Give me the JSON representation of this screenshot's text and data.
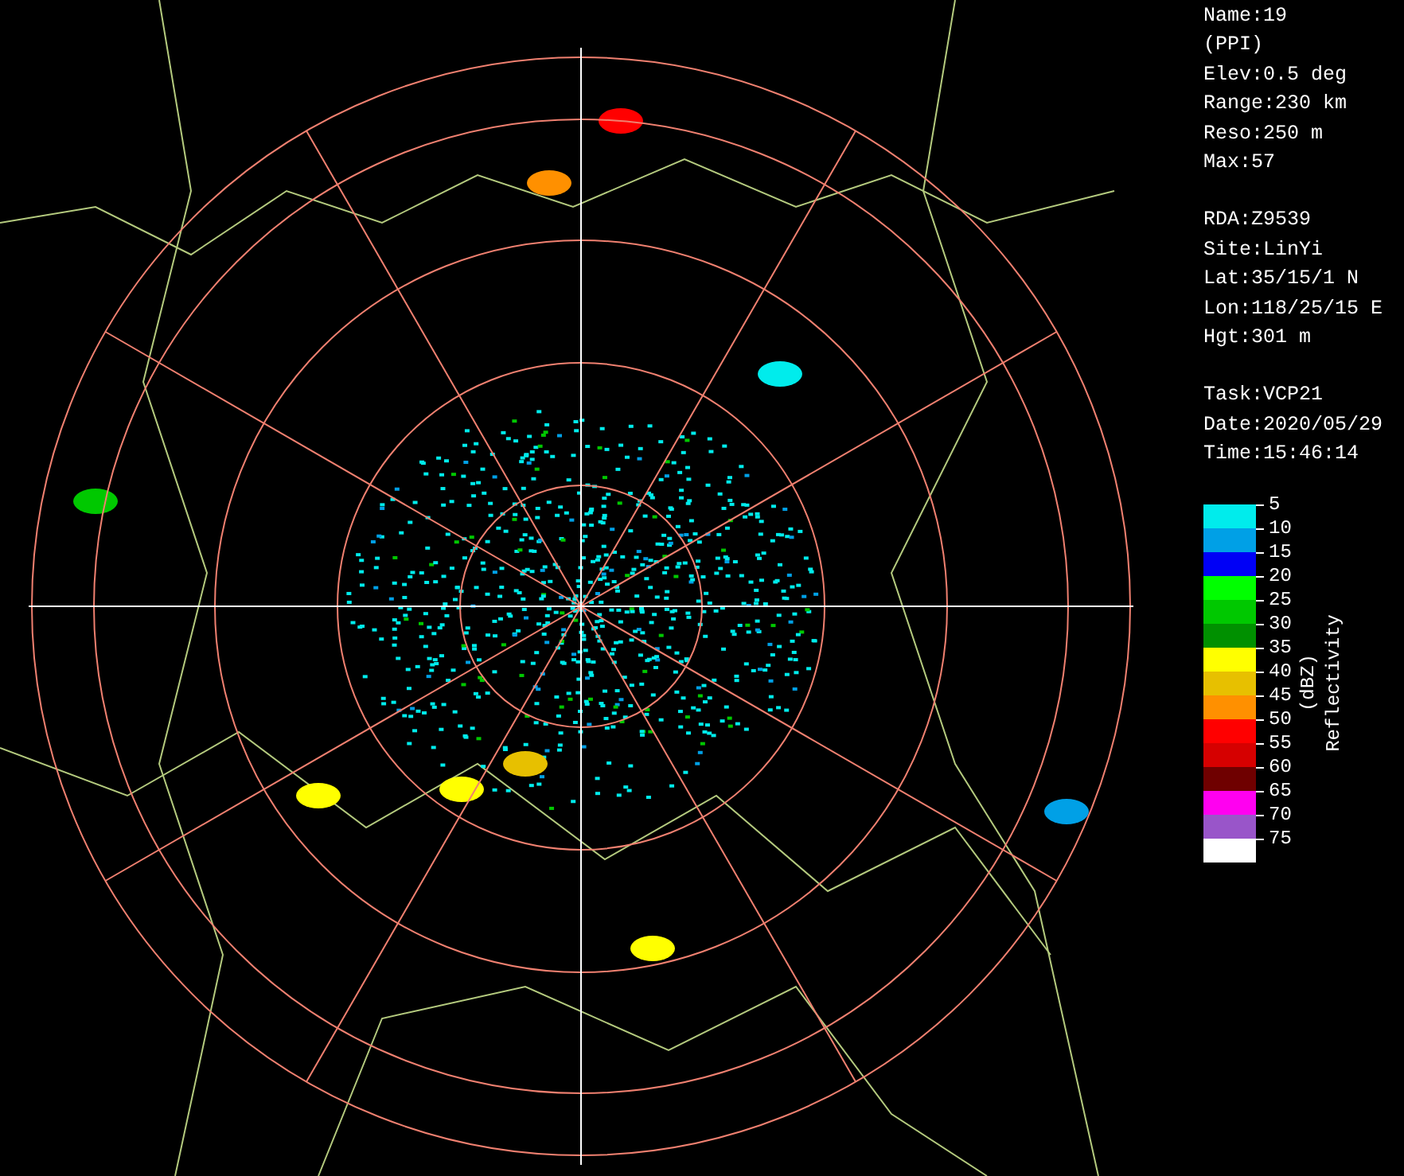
{
  "info_groups": [
    [
      "Name:19",
      "(PPI)",
      "Elev:0.5 deg",
      "Range:230 km",
      "Reso:250 m",
      "Max:57"
    ],
    [
      "RDA:Z9539",
      "Site:LinYi",
      "Lat:35/15/1 N",
      "Lon:118/25/15 E",
      "Hgt:301 m"
    ],
    [
      "Task:VCP21",
      "Date:2020/05/29",
      "Time:15:46:14"
    ]
  ],
  "legend": {
    "title": "Reflectivity",
    "unit": "(dBZ)",
    "bands": [
      {
        "label": "5",
        "color": "#00ecec"
      },
      {
        "label": "10",
        "color": "#00a0e6"
      },
      {
        "label": "15",
        "color": "#0000f6"
      },
      {
        "label": "20",
        "color": "#00ff00"
      },
      {
        "label": "25",
        "color": "#00c800"
      },
      {
        "label": "30",
        "color": "#009000"
      },
      {
        "label": "35",
        "color": "#ffff00"
      },
      {
        "label": "40",
        "color": "#e7c000"
      },
      {
        "label": "45",
        "color": "#ff9000"
      },
      {
        "label": "50",
        "color": "#ff0000"
      },
      {
        "label": "55",
        "color": "#d60000"
      },
      {
        "label": "60",
        "color": "#6f0000"
      },
      {
        "label": "65",
        "color": "#ff00f0"
      },
      {
        "label": "70",
        "color": "#9955c9"
      },
      {
        "label": "75",
        "color": "#ffffff"
      }
    ]
  }
}
